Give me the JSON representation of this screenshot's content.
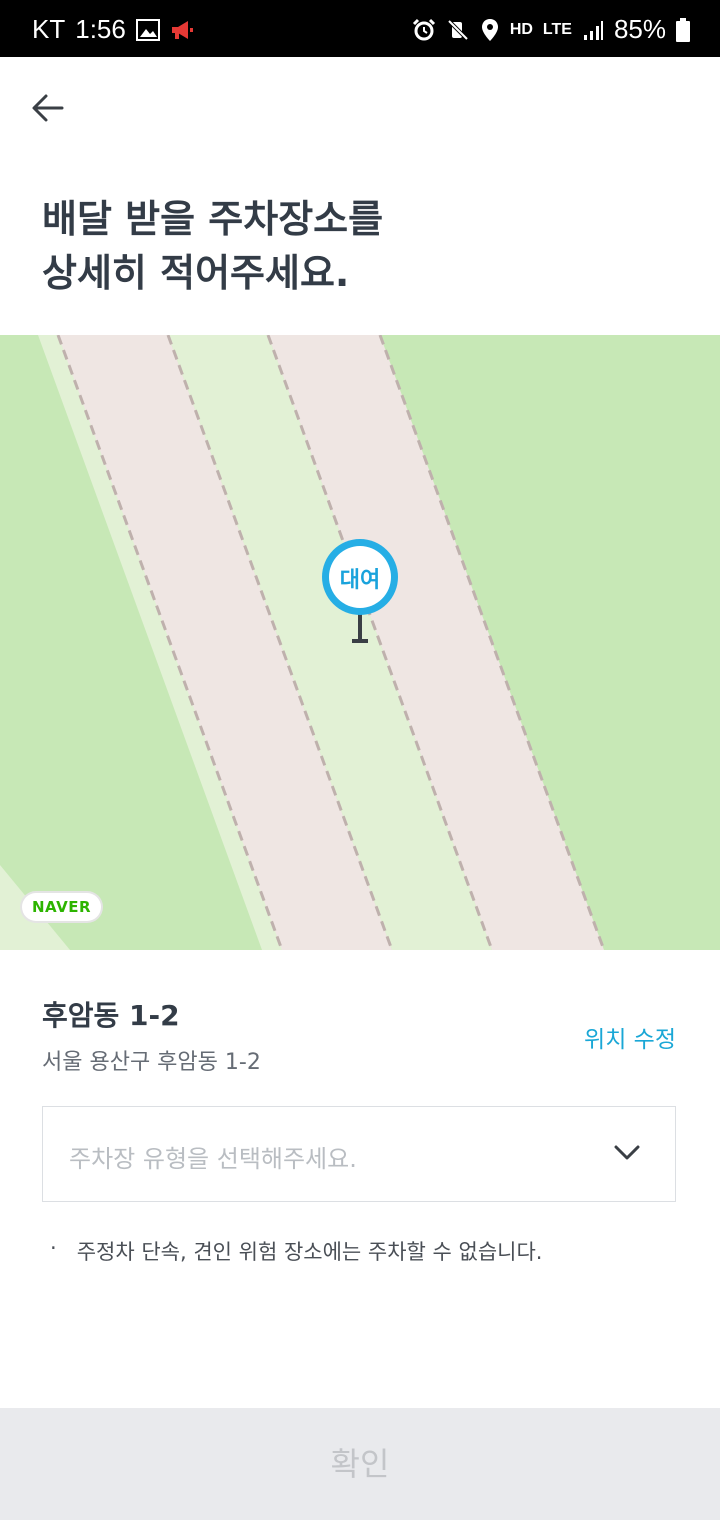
{
  "status_bar": {
    "carrier": "KT",
    "time": "1:56",
    "battery": "85%",
    "network": "LTE",
    "hd": "HD",
    "icons": [
      "image-icon",
      "megaphone-icon",
      "alarm-icon",
      "mute-icon",
      "location-icon",
      "signal-icon",
      "battery-icon"
    ]
  },
  "header": {
    "back_icon": "arrow-left-icon",
    "headline_line1": "배달 받을 주차장소를",
    "headline_line2": "상세히 적어주세요."
  },
  "map": {
    "marker_label": "대여",
    "provider_logo": "NAVER",
    "colors": {
      "park": "#c7e8b6",
      "road": "#efe6e3",
      "median": "#e2f1d5",
      "marker": "#26aee5"
    }
  },
  "address": {
    "title": "후암동 1-2",
    "full": "서울 용산구 후암동 1-2",
    "edit_label": "위치 수정"
  },
  "parking_type": {
    "placeholder": "주차장 유형을 선택해주세요.",
    "icon": "chevron-down-icon"
  },
  "notice": {
    "bullet": "·",
    "text": "주정차 단속, 견인 위험 장소에는 주차할 수 없습니다."
  },
  "footer": {
    "confirm_label": "확인"
  },
  "accent_color": "#1aa7d6"
}
